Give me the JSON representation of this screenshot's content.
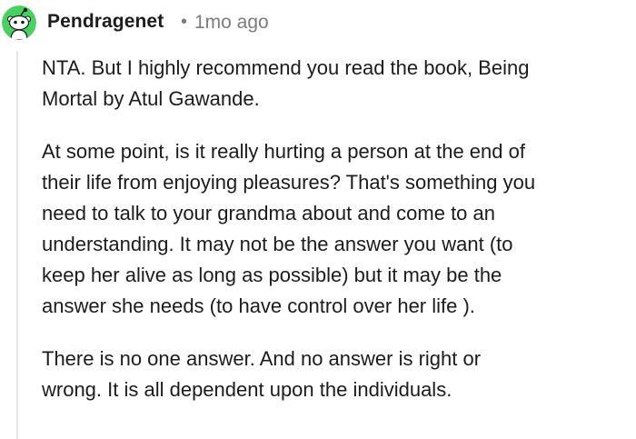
{
  "comment": {
    "author": "Pendragenet",
    "separator": "•",
    "time_ago": "1mo ago",
    "avatar_icon": "snoo-avatar-icon",
    "colors": {
      "avatar_bg": "#46d160",
      "text": "#1c1c1c",
      "meta": "#7c7c7c",
      "thread_line": "#e5e5e5"
    },
    "paragraphs": [
      "NTA. But I highly recommend you read the book, Being\nMortal by Atul Gawande.",
      "At some point, is it really hurting a person at the end of\ntheir life from enjoying pleasures? That's something you\nneed to talk to your grandma about and come to an\nunderstanding. It may not be the answer you want (to\nkeep her alive as long as possible) but it may be the\nanswer she needs (to have control over her life ).",
      "There is no one answer. And no answer is right or\nwrong. It is all dependent upon the individuals."
    ]
  }
}
